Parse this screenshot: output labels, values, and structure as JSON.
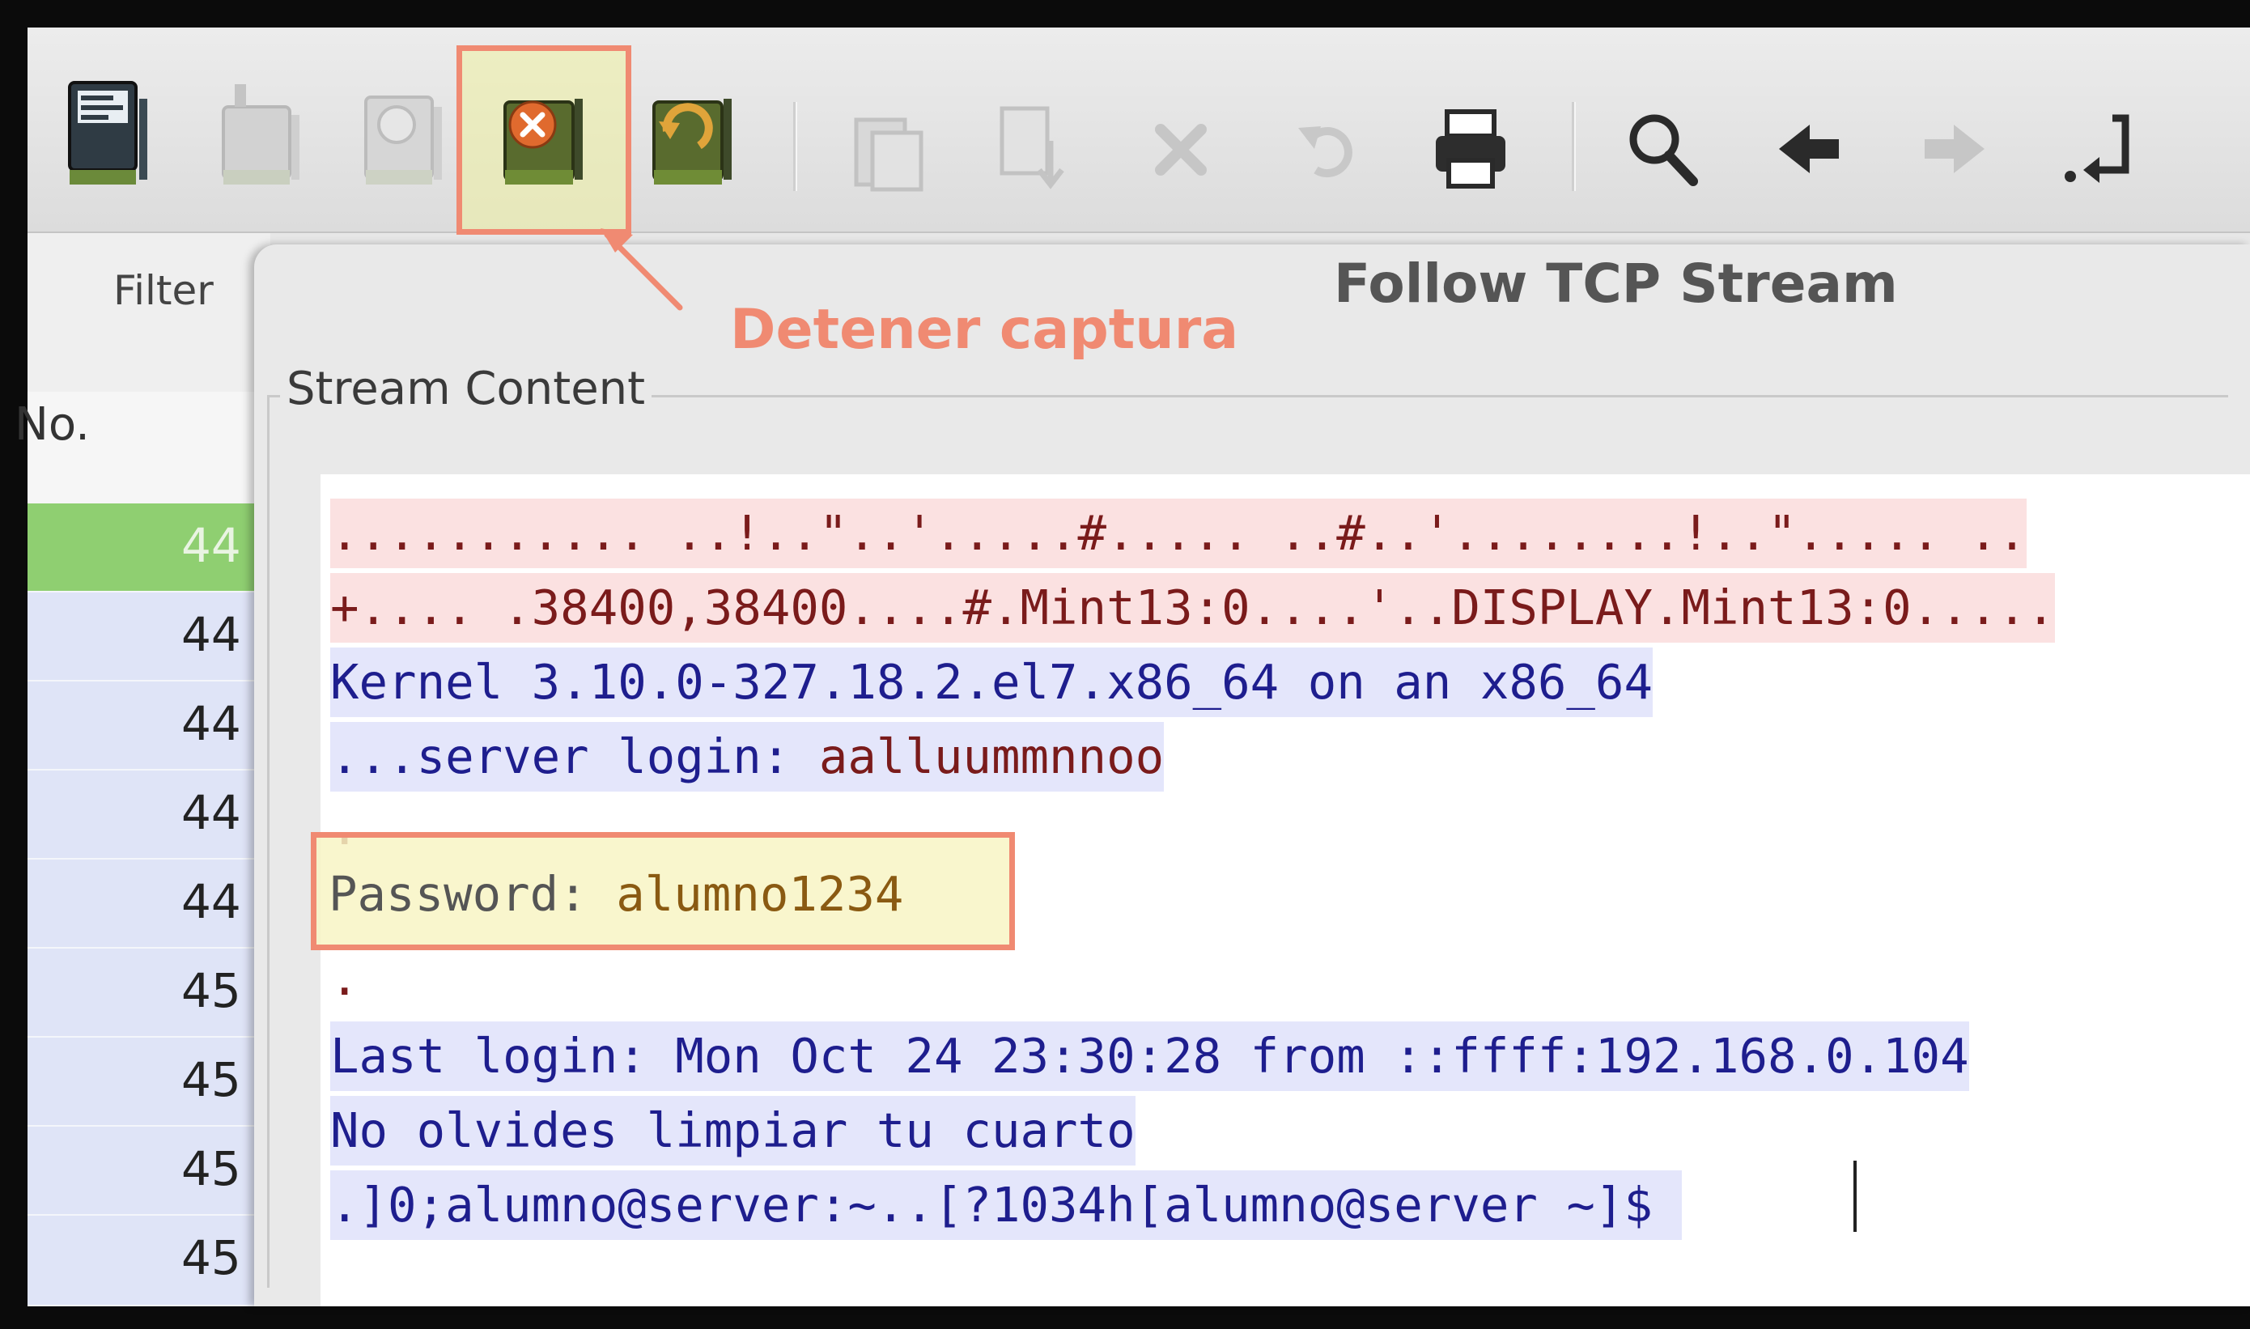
{
  "toolbar": {
    "buttons": [
      {
        "name": "interfaces-icon",
        "enabled": true
      },
      {
        "name": "options-icon",
        "enabled": false
      },
      {
        "name": "start-capture-icon",
        "enabled": false
      },
      {
        "name": "stop-capture-icon",
        "enabled": true,
        "highlighted": true
      },
      {
        "name": "restart-capture-icon",
        "enabled": true
      },
      {
        "name": "open-file-icon",
        "enabled": false
      },
      {
        "name": "save-file-icon",
        "enabled": false
      },
      {
        "name": "close-file-icon",
        "enabled": false
      },
      {
        "name": "reload-icon",
        "enabled": false
      },
      {
        "name": "print-icon",
        "enabled": true
      },
      {
        "name": "search-icon",
        "enabled": true
      },
      {
        "name": "back-arrow-icon",
        "enabled": true
      },
      {
        "name": "forward-arrow-icon",
        "enabled": false
      },
      {
        "name": "go-to-packet-icon",
        "enabled": true
      }
    ]
  },
  "annotation": {
    "label": "Detener captura",
    "color": "#f08a72"
  },
  "filter": {
    "label": "Filter"
  },
  "packet_list": {
    "header_no": "No.",
    "rows": [
      "44",
      "44",
      "44",
      "44",
      "44",
      "45",
      "45",
      "45",
      "45"
    ],
    "selected_index": 0
  },
  "dialog": {
    "title": "Follow TCP Stream",
    "section_label": "Stream Content",
    "lines": [
      {
        "text": "........... ..!..\"..'.....#..... ..#..'........!..\"..... ..",
        "kind": "client"
      },
      {
        "text": "+.... .38400,38400....#.Mint13:0....'..DISPLAY.Mint13:0.....",
        "kind": "client"
      },
      {
        "text": "Kernel 3.10.0-327.18.2.el7.x86_64 on an x86_64",
        "kind": "server"
      },
      {
        "prefix": "...server login: ",
        "suffix": "aalluummnnoo",
        "kind": "mixed"
      },
      {
        "text": ".",
        "kind": "dot"
      },
      {
        "prefix": "Password: ",
        "suffix": "alumno1234",
        "kind": "password"
      },
      {
        "text": ".",
        "kind": "dot"
      },
      {
        "text": "Last login: Mon Oct 24 23:30:28 from ::ffff:192.168.0.104",
        "kind": "server"
      },
      {
        "text": "No olvides limpiar tu cuarto",
        "kind": "server"
      },
      {
        "text": ".]0;alumno@server:~..[?1034h[alumno@server ~]$ ",
        "kind": "server"
      }
    ]
  },
  "colors": {
    "client_text": "#7a1b1b",
    "client_bg": "#fbe1e1",
    "server_text": "#1e1e8e",
    "server_bg": "#e4e6fb",
    "selected_row": "#8fcf71"
  }
}
